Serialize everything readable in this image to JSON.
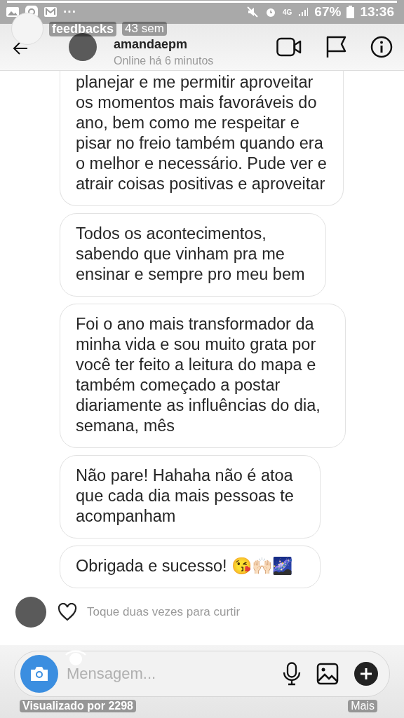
{
  "status_bar": {
    "network": "4G",
    "battery": "67%",
    "time": "13:36",
    "more": "···"
  },
  "story": {
    "level": 1,
    "title": "feedbacks",
    "age": "43 sem",
    "views": "Visualizado por 2298",
    "more": "Mais"
  },
  "header": {
    "username": "amandaepm",
    "status": "Online há 6 minutos"
  },
  "messages": [
    {
      "text": "planejar e me permitir aproveitar os momentos mais favoráveis do ano, bem como me respeitar e pisar no freio também quando era o melhor e necessário. Pude ver e atrair coisas positivas e aproveitar",
      "cut_top": true
    },
    {
      "text": "Todos os acontecimentos, sabendo que vinham pra me ensinar e sempre pro meu bem",
      "cut_top": false
    },
    {
      "text": "Foi o ano mais transformador da minha vida e sou muito grata por você ter feito a leitura do mapa e também começado a postar diariamente as influências do dia, semana, mês",
      "cut_top": false
    },
    {
      "text": "Não pare! Hahaha não é atoa que cada dia mais pessoas te acompanham",
      "cut_top": false
    },
    {
      "text": "Obrigada e sucesso! 😘🙌🏻🌌",
      "cut_top": false
    }
  ],
  "like_hint": "Toque duas vezes para curtir",
  "composer": {
    "placeholder": "Mensagem..."
  }
}
